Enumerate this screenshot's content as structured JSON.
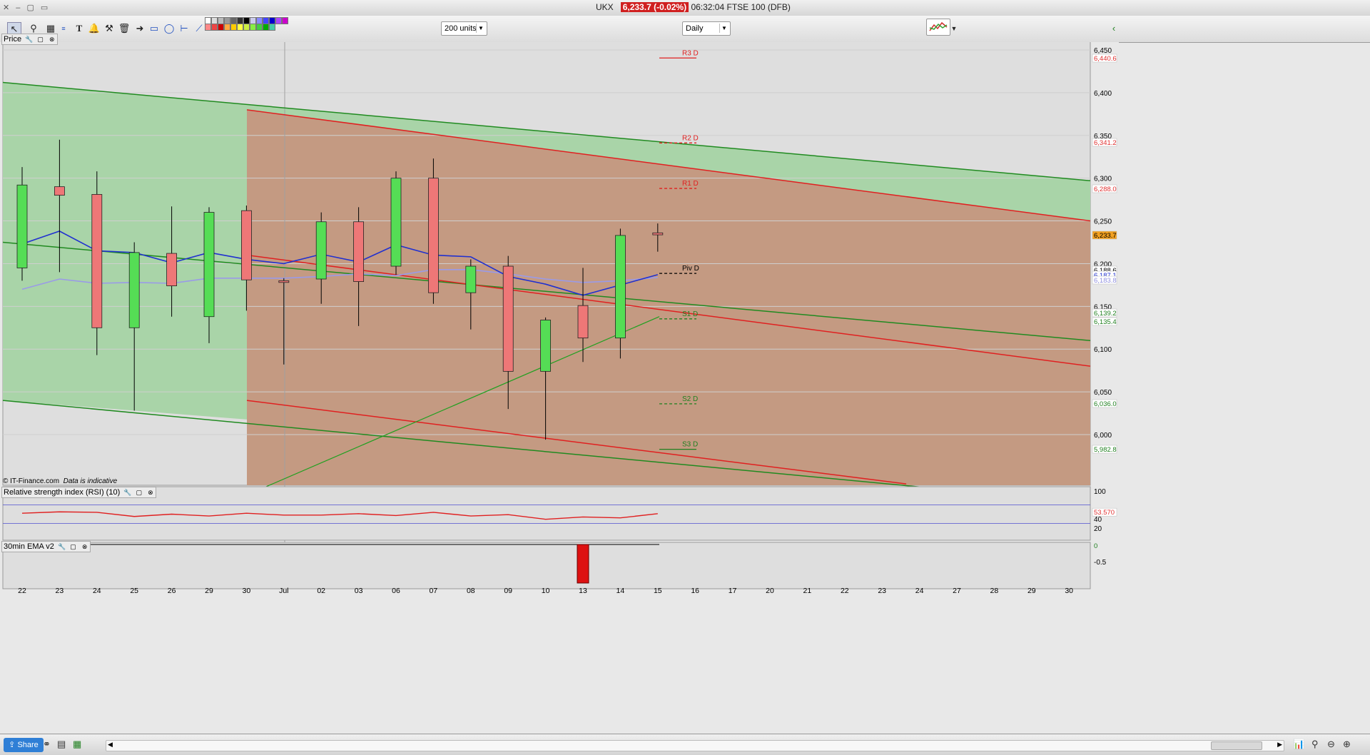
{
  "window": {
    "symbol": "UKX",
    "price_badge": "6,233.7 (-0.02%)",
    "title_rest": "06:32:04 FTSE 100 (DFB)"
  },
  "toolbar": {
    "units_value": "200 units",
    "interval_value": "Daily",
    "tools": [
      "pointer-icon",
      "zoom-icon",
      "chart-type-icon",
      "text-tool-icon",
      "fib-icon",
      "alert-bell-icon",
      "hammer-icon",
      "trash-icon",
      "arrow-right-icon",
      "rectangle-icon",
      "ellipse-icon",
      "horizontal-line-icon",
      "trend-line-icon"
    ]
  },
  "price_panel": {
    "label": "Price",
    "copyright": "© IT-Finance.com",
    "disclaimer": "Data is indicative",
    "current_price": "6,233.7"
  },
  "rsi_panel": {
    "label": "Relative strength index (RSI) (10)",
    "value_badge": "53.570",
    "levels": [
      100,
      40,
      20
    ]
  },
  "ema_panel": {
    "label": "30min EMA v2",
    "value_badge": "0",
    "tick": "-0.5"
  },
  "price_axis": {
    "ticks": [
      "6,450",
      "6,400",
      "6,350",
      "6,300",
      "6,250",
      "6,200",
      "6,150",
      "6,100",
      "6,050",
      "6,000"
    ],
    "badges": [
      {
        "text": "6,440.6",
        "color": "#e03030",
        "bg": "#fff"
      },
      {
        "text": "6,341.2",
        "color": "#e03030",
        "bg": "#fff"
      },
      {
        "text": "6,288.0",
        "color": "#e03030",
        "bg": "#fff"
      },
      {
        "text": "6,233.7",
        "color": "#000",
        "bg": "#f2a020"
      },
      {
        "text": "6,188.6",
        "color": "#000",
        "bg": "#fff"
      },
      {
        "text": "6,187.1",
        "color": "#2030d0",
        "bg": "#fff"
      },
      {
        "text": "6,183.8",
        "color": "#9090e0",
        "bg": "#fff"
      },
      {
        "text": "6,139.2",
        "color": "#208020",
        "bg": "#fff"
      },
      {
        "text": "6,135.4",
        "color": "#208020",
        "bg": "#fff"
      },
      {
        "text": "6,036.0",
        "color": "#208020",
        "bg": "#fff"
      },
      {
        "text": "5,982.8",
        "color": "#208020",
        "bg": "#fff"
      }
    ]
  },
  "pivots": [
    {
      "label": "R3 D",
      "value": 6440.6,
      "color": "#e02020",
      "dash": false
    },
    {
      "label": "R2 D",
      "value": 6341.2,
      "color": "#e02020",
      "dash": true
    },
    {
      "label": "R1 D",
      "value": 6288.0,
      "color": "#e02020",
      "dash": true
    },
    {
      "label": "Piv D",
      "value": 6188.6,
      "color": "#000000",
      "dash": true
    },
    {
      "label": "S1 D",
      "value": 6135.4,
      "color": "#208020",
      "dash": true
    },
    {
      "label": "S2 D",
      "value": 6036.0,
      "color": "#208020",
      "dash": true
    },
    {
      "label": "S3 D",
      "value": 5982.8,
      "color": "#208020",
      "dash": false
    }
  ],
  "chart_data": {
    "type": "candlestick",
    "x_labels": [
      "22",
      "23",
      "24",
      "25",
      "26",
      "29",
      "30",
      "Jul",
      "02",
      "03",
      "06",
      "07",
      "08",
      "09",
      "10",
      "13",
      "14",
      "15",
      "16",
      "17",
      "20",
      "21",
      "22",
      "23",
      "24",
      "27",
      "28",
      "29",
      "30"
    ],
    "ylim": [
      5940,
      6465
    ],
    "candles": [
      {
        "x": "22",
        "open": 6195,
        "high": 6313,
        "low": 6180,
        "close": 6292
      },
      {
        "x": "23",
        "open": 6290,
        "high": 6345,
        "low": 6190,
        "close": 6280
      },
      {
        "x": "24",
        "open": 6281,
        "high": 6308,
        "low": 6093,
        "close": 6125
      },
      {
        "x": "25",
        "open": 6125,
        "high": 6225,
        "low": 6028,
        "close": 6213
      },
      {
        "x": "26",
        "open": 6212,
        "high": 6267,
        "low": 6138,
        "close": 6174
      },
      {
        "x": "29",
        "open": 6138,
        "high": 6266,
        "low": 6107,
        "close": 6260
      },
      {
        "x": "30",
        "open": 6262,
        "high": 6268,
        "low": 6145,
        "close": 6181
      },
      {
        "x": "Jul",
        "open": 6180,
        "high": 6183,
        "low": 6082,
        "close": 6178
      },
      {
        "x": "02",
        "open": 6182,
        "high": 6260,
        "low": 6153,
        "close": 6249
      },
      {
        "x": "03",
        "open": 6249,
        "high": 6266,
        "low": 6127,
        "close": 6179
      },
      {
        "x": "06",
        "open": 6197,
        "high": 6308,
        "low": 6187,
        "close": 6300
      },
      {
        "x": "07",
        "open": 6300,
        "high": 6323,
        "low": 6153,
        "close": 6166
      },
      {
        "x": "08",
        "open": 6166,
        "high": 6205,
        "low": 6123,
        "close": 6197
      },
      {
        "x": "09",
        "open": 6197,
        "high": 6209,
        "low": 6030,
        "close": 6074
      },
      {
        "x": "10",
        "open": 6074,
        "high": 6137,
        "low": 5994,
        "close": 6134
      },
      {
        "x": "13",
        "open": 6151,
        "high": 6195,
        "low": 6085,
        "close": 6113
      },
      {
        "x": "14",
        "open": 6113,
        "high": 6241,
        "low": 6089,
        "close": 6233
      },
      {
        "x": "15",
        "open": 6236,
        "high": 6247,
        "low": 6214,
        "close": 6233.7
      }
    ],
    "ma_fast": [
      6223,
      6238,
      6215,
      6213,
      6201,
      6213,
      6205,
      6200,
      6211,
      6202,
      6222,
      6210,
      6208,
      6185,
      6176,
      6163,
      6175,
      6187.1
    ],
    "ma_slow": [
      6170,
      6182,
      6177,
      6178,
      6177,
      6183,
      6183,
      6183,
      6185,
      6188,
      6186,
      6193,
      6193,
      6188,
      6182,
      6178,
      6180,
      6183.8
    ],
    "rsi": [
      52,
      55,
      54,
      45,
      50,
      46,
      52,
      48,
      48,
      51,
      47,
      54,
      46,
      49,
      39,
      44,
      42,
      51,
      53.57
    ]
  }
}
